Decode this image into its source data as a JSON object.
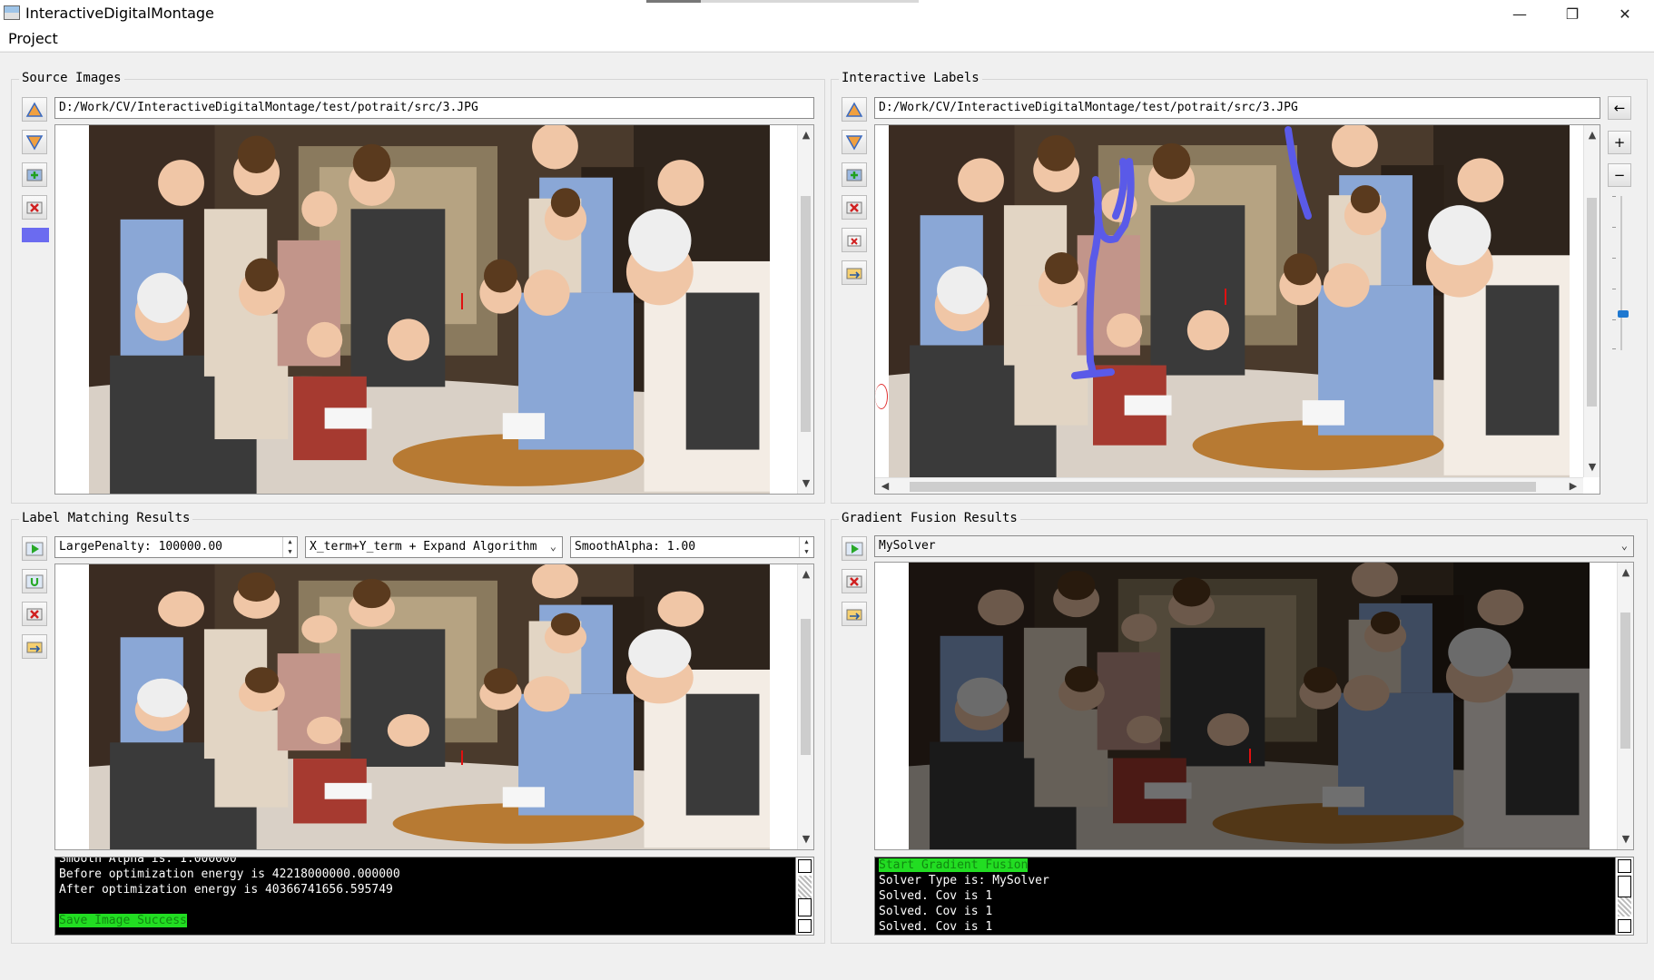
{
  "window": {
    "title": "InteractiveDigitalMontage",
    "progress_fraction": 0.2
  },
  "menu": {
    "items": [
      {
        "label": "Project"
      }
    ]
  },
  "source_images": {
    "title": "Source Images",
    "path": "D:/Work/CV/InteractiveDigitalMontage/test/potrait/src/3.JPG",
    "brush_color": "#6b6bf0"
  },
  "interactive_labels": {
    "title": "Interactive Labels",
    "path": "D:/Work/CV/InteractiveDigitalMontage/test/potrait/src/3.JPG",
    "stroke_color": "#5a5ae8",
    "zoom_in": "+",
    "zoom_out": "−",
    "back": "←"
  },
  "label_matching": {
    "title": "Label Matching Results",
    "large_penalty": "LargePenalty: 100000.00",
    "algorithm": "X_term+Y_term + Expand Algorithm",
    "smooth_alpha": "SmoothAlpha: 1.00",
    "log": [
      {
        "text": "Smooth Alpha is: 1.000000",
        "highlight": false
      },
      {
        "text": "Before optimization energy is 42218000000.000000",
        "highlight": false
      },
      {
        "text": "After optimization energy is 40366741656.595749",
        "highlight": false
      },
      {
        "text": "",
        "highlight": false
      },
      {
        "text": "Save Image Success",
        "highlight": true
      }
    ]
  },
  "gradient_fusion": {
    "title": "Gradient Fusion Results",
    "solver": "MySolver",
    "log": [
      {
        "text": "Start Gradient Fusion",
        "highlight": true
      },
      {
        "text": "Solver Type is: MySolver",
        "highlight": false
      },
      {
        "text": "Solved. Cov is 1",
        "highlight": false
      },
      {
        "text": "Solved. Cov is 1",
        "highlight": false
      },
      {
        "text": "Solved. Cov is 1",
        "highlight": false
      }
    ]
  },
  "colors": {
    "accent_green": "#22dd22",
    "console_bg": "#000000",
    "window_bg": "#f0f0f0"
  }
}
